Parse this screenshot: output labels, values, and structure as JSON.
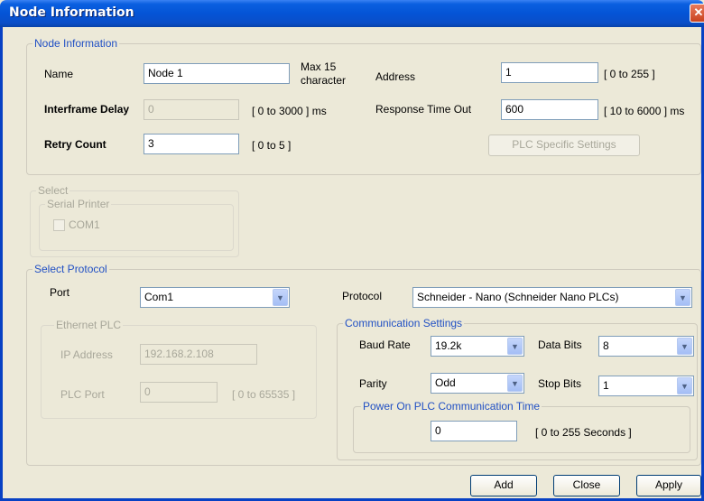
{
  "window": {
    "title": "Node Information",
    "close_glyph": "✕"
  },
  "node_info": {
    "legend": "Node Information",
    "name_label": "Name",
    "name_value": "Node 1",
    "name_hint_1": "Max 15",
    "name_hint_2": "character",
    "address_label": "Address",
    "address_value": "1",
    "address_hint": "[ 0 to 255 ]",
    "interframe_label": "Interframe Delay",
    "interframe_value": "0",
    "interframe_hint": "[ 0 to 3000 ] ms",
    "response_label": "Response Time Out",
    "response_value": "600",
    "response_hint": "[ 10 to 6000 ] ms",
    "retry_label": "Retry Count",
    "retry_value": "3",
    "retry_hint": "[ 0 to 5 ]",
    "plc_settings_button": "PLC Specific Settings"
  },
  "select_group": {
    "legend": "Select",
    "printer_legend": "Serial Printer",
    "com1_label": "COM1"
  },
  "protocol_group": {
    "legend": "Select Protocol",
    "port_label": "Port",
    "port_value": "Com1",
    "protocol_label": "Protocol",
    "protocol_value": "Schneider - Nano (Schneider Nano PLCs)",
    "ethernet_legend": "Ethernet PLC",
    "ip_label": "IP Address",
    "ip_value": "192.168.2.108",
    "plcport_label": "PLC Port",
    "plcport_value": "0",
    "plcport_hint": "[ 0 to 65535 ]",
    "comm_legend": "Communication Settings",
    "baud_label": "Baud Rate",
    "baud_value": "19.2k",
    "databits_label": "Data Bits",
    "databits_value": "8",
    "parity_label": "Parity",
    "parity_value": "Odd",
    "stopbits_label": "Stop Bits",
    "stopbits_value": "1",
    "poweron_legend": "Power On PLC Communication Time",
    "poweron_value": "0",
    "poweron_hint": "[ 0 to 255 Seconds ]"
  },
  "buttons": {
    "add": "Add",
    "close": "Close",
    "apply": "Apply"
  },
  "icons": {
    "dropdown": "▼"
  }
}
